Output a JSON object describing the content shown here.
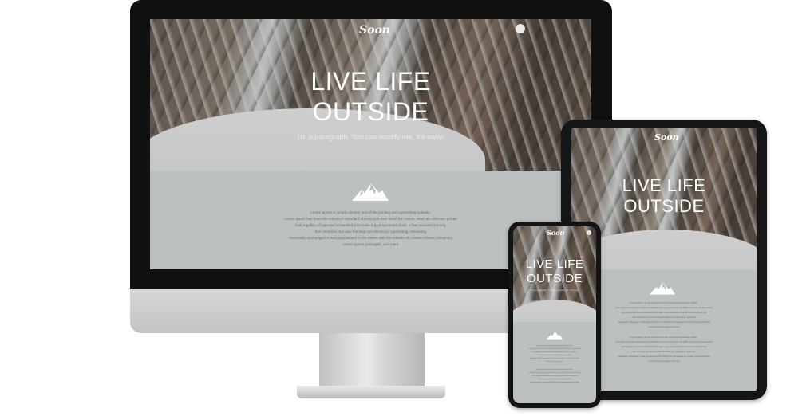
{
  "brand": {
    "logo": "Soon"
  },
  "hero": {
    "title_line1": "LIVE LIFE",
    "title_line2": "OUTSIDE",
    "subtitle": "I'm a paragraph. You can modify me. It's easy!"
  },
  "desktop_body": {
    "lines": [
      "Lorem Ipsum is simply dummy text of the printing and typesetting industry.",
      "Lorem Ipsum has been the industry's standard dummy text ever since the 1500s, when an unknown printer",
      "took a galley of type and scrambled it to make a type specimen book. It has survived not only",
      "five centuries, but also the leap into electronic typesetting, remaining",
      "essentially unchanged. It was popularised in the 1960s with the release of Letraset sheets containing",
      "Lorem Ipsum passages, and more"
    ]
  },
  "colors": {
    "screen_grey": "#bbc0c1",
    "bezel": "#111111",
    "stand": "#c9cacb"
  },
  "icons": {
    "mountain": "mountain-icon",
    "menu": "menu-dot-icon"
  }
}
